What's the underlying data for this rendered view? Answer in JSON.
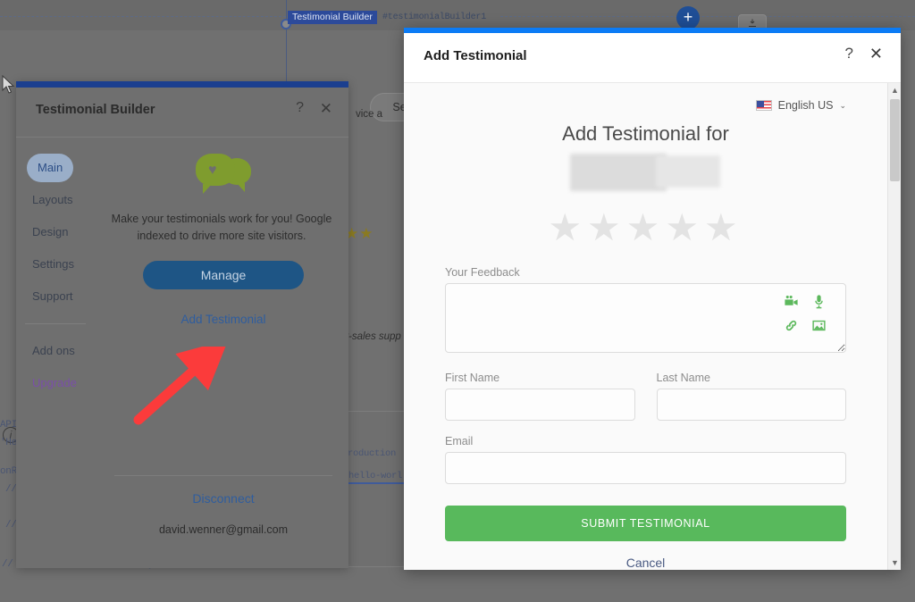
{
  "background": {
    "node_tab_label": "Testimonial Builder",
    "node_id": "#testimonialBuilder1",
    "add_button_label": "+",
    "download_button_icon": "download-icon",
    "settings_pill_label": "Settings",
    "snippet_service": "vice a",
    "snippet_support": "er-sales supp",
    "stars": "★★",
    "info_icon": "info-icon",
    "code_lines": [
      "API",
      "'Hel",
      "onRe",
      "//",
      "//"
    ],
    "file_tabs": [
      "troduction",
      "hello-worl"
    ],
    "bottom_comment": "// Click 'Preview' to run your code"
  },
  "testimonial_builder": {
    "title": "Testimonial Builder",
    "help_label": "?",
    "close_label": "✕",
    "nav": [
      {
        "label": "Main",
        "selected": true
      },
      {
        "label": "Layouts",
        "selected": false
      },
      {
        "label": "Design",
        "selected": false
      },
      {
        "label": "Settings",
        "selected": false
      },
      {
        "label": "Support",
        "selected": false
      }
    ],
    "nav_secondary": [
      {
        "label": "Add ons",
        "style": "normal"
      },
      {
        "label": "Upgrade",
        "style": "upgrade"
      }
    ],
    "logo_icon": "speech-bubbles-heart-icon",
    "blurb": "Make your testimonials work for you! Google indexed to drive more site visitors.",
    "manage_label": "Manage",
    "add_testimonial_label": "Add Testimonial",
    "disconnect_label": "Disconnect",
    "account_email": "david.wenner@gmail.com",
    "accent_color": "#1b3f8f",
    "logo_color": "#7f9c2e",
    "upgrade_color": "#7a4fa8"
  },
  "annotation": {
    "arrow_color": "#fb3b3b",
    "points_to": "Add Testimonial"
  },
  "add_testimonial": {
    "title": "Add Testimonial",
    "help_label": "?",
    "close_label": "✕",
    "accent_color": "#0b7bf5",
    "language": {
      "flag": "us-flag-icon",
      "label": "English US",
      "caret": "⌄"
    },
    "heading": "Add Testimonial for",
    "subject_redacted": true,
    "rating": {
      "total": 5,
      "selected": 0,
      "glyph": "★",
      "empty_color": "#e3e3e3"
    },
    "feedback": {
      "label": "Your Feedback",
      "value": "",
      "tools": [
        "video-camera-icon",
        "microphone-icon",
        "link-icon",
        "image-icon"
      ],
      "tool_color": "#5cb85c"
    },
    "fields": [
      {
        "label": "First Name",
        "value": ""
      },
      {
        "label": "Last Name",
        "value": ""
      },
      {
        "label": "Email",
        "value": ""
      }
    ],
    "submit_label": "SUBMIT TESTIMONIAL",
    "submit_color": "#58b95c",
    "cancel_label": "Cancel",
    "scrollbar": {
      "up": "▲",
      "down": "▼"
    }
  }
}
